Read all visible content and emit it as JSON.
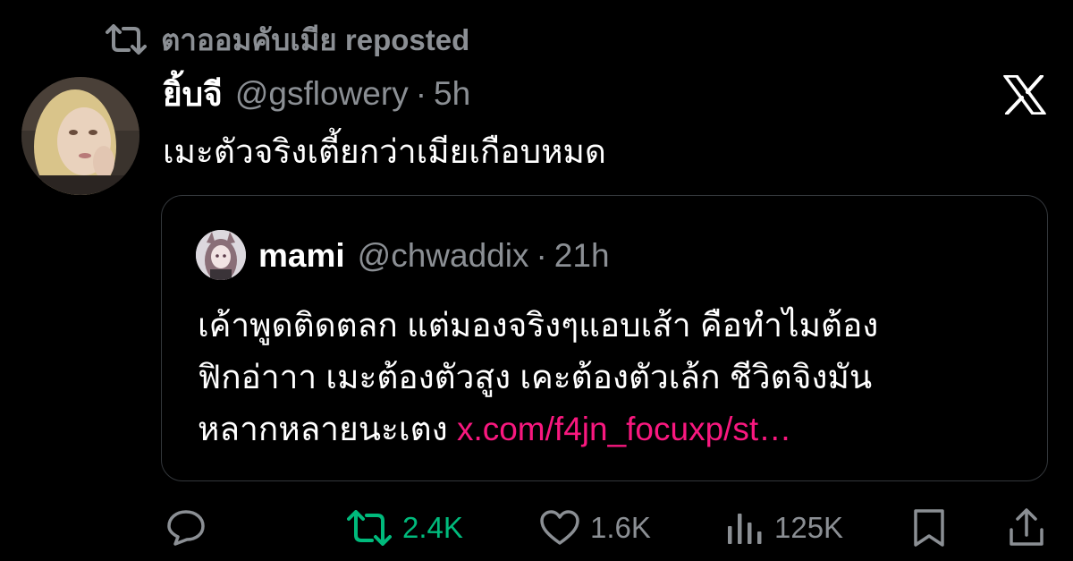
{
  "repost": {
    "text": "ตาออมคับเมีย reposted",
    "icon": "repost-icon"
  },
  "tweet": {
    "display_name": "ยิ้บจี",
    "handle": "@gsflowery",
    "separator": "·",
    "time": "5h",
    "text": "เมะตัวจริงเตี้ยกว่าเมียเกือบหมด",
    "brand_icon": "x-logo-icon"
  },
  "quote": {
    "display_name": "mami",
    "handle": "@chwaddix",
    "separator": "·",
    "time": "21h",
    "lines": [
      "เค้าพูดติดตลก แต่มองจริงๆแอบเส้า คือทำไมต้อง",
      "ฟิกอ่าาา เมะต้องตัวสูง เคะต้องตัวเล้ก ชีวิตจิงมัน",
      "หลากหลายนะเตง"
    ],
    "link": "x.com/f4jn_focuxp/st…"
  },
  "actions": {
    "reply": {
      "icon": "reply-icon",
      "count": ""
    },
    "repost": {
      "icon": "repost-icon",
      "count": "2.4K",
      "active_color": "#00ba7c"
    },
    "like": {
      "icon": "heart-icon",
      "count": "1.6K"
    },
    "views": {
      "icon": "views-icon",
      "count": "125K"
    },
    "bookmark": {
      "icon": "bookmark-icon"
    },
    "share": {
      "icon": "share-icon"
    }
  },
  "colors": {
    "background": "#000000",
    "text": "#ffffff",
    "muted": "#8b8f94",
    "link": "#f9187f",
    "border": "#33373b"
  }
}
